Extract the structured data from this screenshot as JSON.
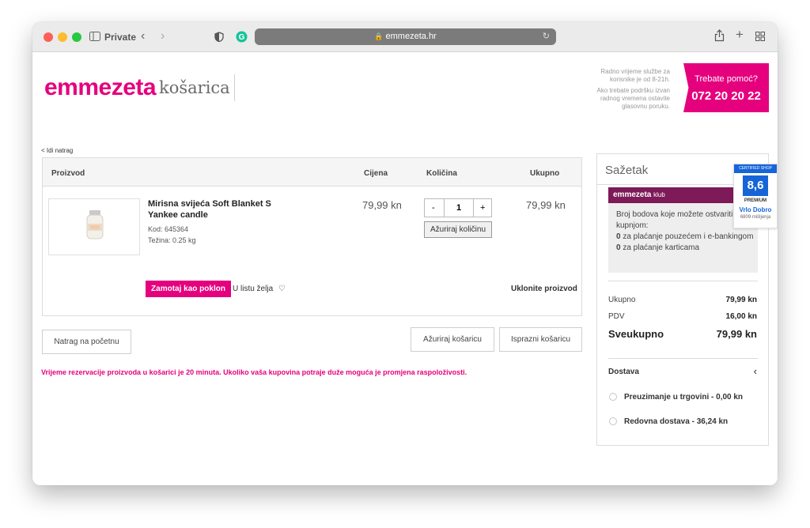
{
  "browser": {
    "private_label": "Private",
    "url": "emmezeta.hr",
    "lock_icon": "lock-icon",
    "share_icon": "share-icon",
    "plus_icon": "new-tab-icon",
    "tabs_icon": "tab-overview-icon"
  },
  "header": {
    "logo": "emmezeta",
    "logo_sub": "košarica",
    "work_time_1": "Radno vrijeme službe za korisnike je od 8-21h.",
    "work_time_2": "Ako trebate podršku izvan radnog vremena ostavite glasovnu poruku.",
    "help_title": "Trebate pomoć?",
    "help_phone": "072 20 20 22"
  },
  "nav": {
    "back": "< Idi natrag"
  },
  "cart": {
    "columns": {
      "product": "Proizvod",
      "price": "Cijena",
      "quantity": "Količina",
      "total": "Ukupno"
    },
    "item": {
      "name": "Mirisna svijeća Soft Blanket S Yankee candle",
      "code": "Kod: 645364",
      "weight": "Težina: 0.25 kg",
      "price": "79,99 kn",
      "qty_minus": "-",
      "quantity": "1",
      "qty_plus": "+",
      "update_qty": "Ažuriraj količinu",
      "total": "79,99 kn",
      "gift": "Zamotaj kao poklon",
      "wishlist": "U listu želja",
      "remove": "Uklonite proizvod"
    },
    "btn_home": "Natrag na početnu",
    "btn_update": "Ažuriraj košaricu",
    "btn_empty": "Isprazni košaricu",
    "notice": "Vrijeme rezervacije proizvoda u košarici je 20 minuta. Ukoliko vaša kupovina potraje duže moguća je promjena raspoloživosti."
  },
  "summary": {
    "title": "Sažetak",
    "klub_brand": "emmezeta",
    "klub_sub": "klub",
    "klub_intro": "Broj bodova koje možete ostvariti ovom kupnjom:",
    "klub_p1_num": "0",
    "klub_p1_text": "za plaćanje pouzećem i e-bankingom",
    "klub_p2_num": "0",
    "klub_p2_text": "za plaćanje karticama",
    "total_label": "Ukupno",
    "total_value": "79,99 kn",
    "vat_label": "PDV",
    "vat_value": "16,00 kn",
    "grand_label": "Sveukupno",
    "grand_value": "79,99 kn",
    "delivery_label": "Dostava",
    "ship_1": "Preuzimanje u trgovini - 0,00 kn",
    "ship_2": "Redovna dostava - 36,24 kn"
  },
  "badge": {
    "top": "CERTIFIED SHOP",
    "score": "8,6",
    "tier": "PREMIUM",
    "rating": "Vrlo Dobro",
    "reviews": "6809 mišljenja"
  },
  "colors": {
    "brand": "#e5007e",
    "klub": "#7d1a57",
    "badge": "#1665d8"
  }
}
